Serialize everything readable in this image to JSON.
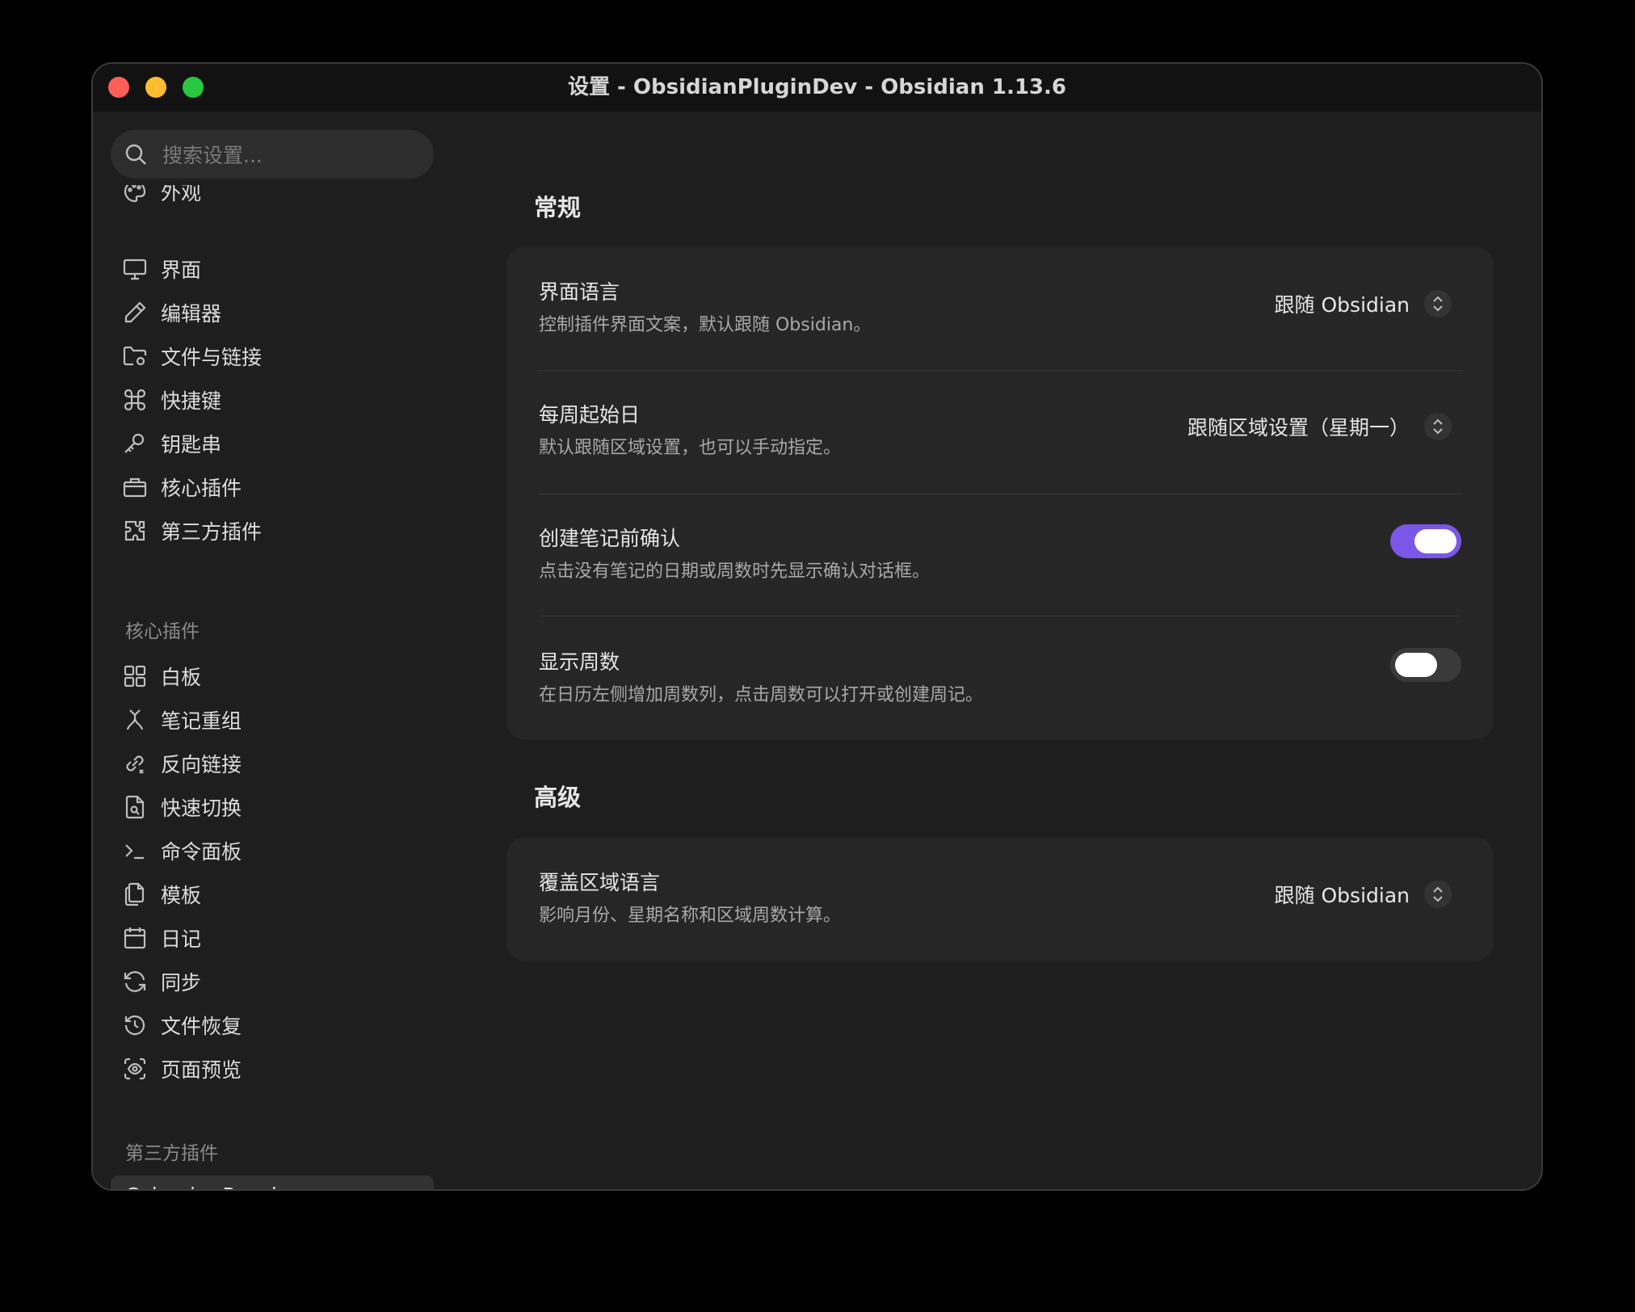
{
  "window": {
    "title": "设置 - ObsidianPluginDev - Obsidian 1.13.6"
  },
  "sidebar": {
    "search_placeholder": "搜索设置...",
    "items": [
      {
        "label": "外观",
        "icon": "palette-icon"
      },
      {
        "label": "界面",
        "icon": "monitor-icon"
      },
      {
        "label": "编辑器",
        "icon": "pencil-icon"
      },
      {
        "label": "文件与链接",
        "icon": "folder-cog-icon"
      },
      {
        "label": "快捷键",
        "icon": "command-icon"
      },
      {
        "label": "钥匙串",
        "icon": "key-icon"
      },
      {
        "label": "核心插件",
        "icon": "briefcase-icon"
      },
      {
        "label": "第三方插件",
        "icon": "puzzle-icon"
      }
    ],
    "core_group_title": "核心插件",
    "core_items": [
      {
        "label": "白板",
        "icon": "grid-icon"
      },
      {
        "label": "笔记重组",
        "icon": "merge-icon"
      },
      {
        "label": "反向链接",
        "icon": "link-icon"
      },
      {
        "label": "快速切换",
        "icon": "file-search-icon"
      },
      {
        "label": "命令面板",
        "icon": "terminal-icon"
      },
      {
        "label": "模板",
        "icon": "files-icon"
      },
      {
        "label": "日记",
        "icon": "calendar-icon"
      },
      {
        "label": "同步",
        "icon": "refresh-icon"
      },
      {
        "label": "文件恢复",
        "icon": "history-icon"
      },
      {
        "label": "页面预览",
        "icon": "scan-eye-icon"
      }
    ],
    "third_group_title": "第三方插件",
    "third_items": [
      {
        "label": "Calendar Panel"
      }
    ]
  },
  "main": {
    "sections": [
      {
        "title": "常规",
        "rows": [
          {
            "name": "界面语言",
            "desc": "控制插件界面文案，默认跟随 Obsidian。",
            "control": "select",
            "value": "跟随 Obsidian"
          },
          {
            "name": "每周起始日",
            "desc": "默认跟随区域设置，也可以手动指定。",
            "control": "select",
            "value": "跟随区域设置（星期一）"
          },
          {
            "name": "创建笔记前确认",
            "desc": "点击没有笔记的日期或周数时先显示确认对话框。",
            "control": "toggle",
            "value": true
          },
          {
            "name": "显示周数",
            "desc": "在日历左侧增加周数列，点击周数可以打开或创建周记。",
            "control": "toggle",
            "value": false
          }
        ]
      },
      {
        "title": "高级",
        "rows": [
          {
            "name": "覆盖区域语言",
            "desc": "影响月份、星期名称和区域周数计算。",
            "control": "select",
            "value": "跟随 Obsidian"
          }
        ]
      }
    ]
  },
  "colors": {
    "accent": "#7a57e6",
    "background": "#1e1e1e",
    "card": "#262626",
    "titlebar": "#121212"
  }
}
